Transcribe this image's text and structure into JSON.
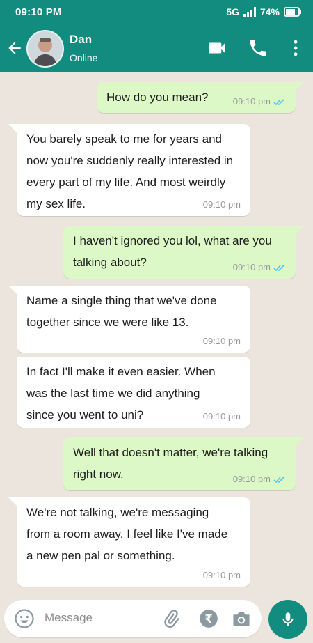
{
  "status_bar": {
    "time": "09:10 PM",
    "network": "5G",
    "battery": "74%"
  },
  "header": {
    "contact_name": "Dan",
    "contact_status": "Online"
  },
  "messages": [
    {
      "direction": "out",
      "text": "How do you mean?",
      "time": "09:10 pm"
    },
    {
      "direction": "in",
      "text": "You barely speak to me for years and now you're suddenly really interested in every part of my life. And most weirdly my sex life.",
      "time": "09:10 pm"
    },
    {
      "direction": "out",
      "text": "I haven't ignored you lol, what are you talking about?",
      "time": "09:10 pm"
    },
    {
      "direction": "in",
      "text": "Name a single thing that we've done together since we were like 13.",
      "time": "09:10 pm"
    },
    {
      "direction": "in",
      "text": "In fact I'll make it even easier. When was the last time we did anything since you went to uni?",
      "time": "09:10 pm"
    },
    {
      "direction": "out",
      "text": "Well that doesn't matter, we're talking right now.",
      "time": "09:10 pm"
    },
    {
      "direction": "in",
      "text": "We're not talking, we're messaging from a room away. I feel like I've made a new pen pal or something.",
      "time": "09:10 pm"
    }
  ],
  "composer": {
    "placeholder": "Message"
  },
  "colors": {
    "brand": "#128c7e",
    "outgoing": "#dcf8c6",
    "incoming": "#ffffff",
    "chat_bg": "#ece5dd",
    "read_ticks": "#4fc3f7"
  }
}
